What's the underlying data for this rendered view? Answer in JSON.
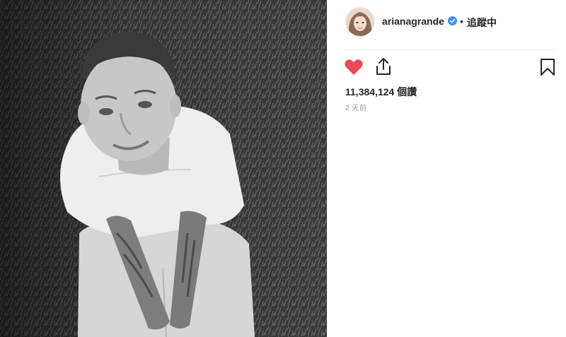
{
  "post": {
    "image_icon": "photo-post",
    "user": {
      "username": "arianagrande",
      "verified": true,
      "dot": "•",
      "follow_status": "追蹤中"
    },
    "actions": {
      "like_icon": "heart-icon",
      "share_icon": "share-icon",
      "save_icon": "bookmark-icon",
      "liked": true
    },
    "likes_text": "11,384,124 個讚",
    "time_ago": "2 天前"
  },
  "colors": {
    "heart": "#ed4956",
    "verified": "#3897f0",
    "text": "#262626",
    "muted": "#999999",
    "divider": "#efefef"
  }
}
